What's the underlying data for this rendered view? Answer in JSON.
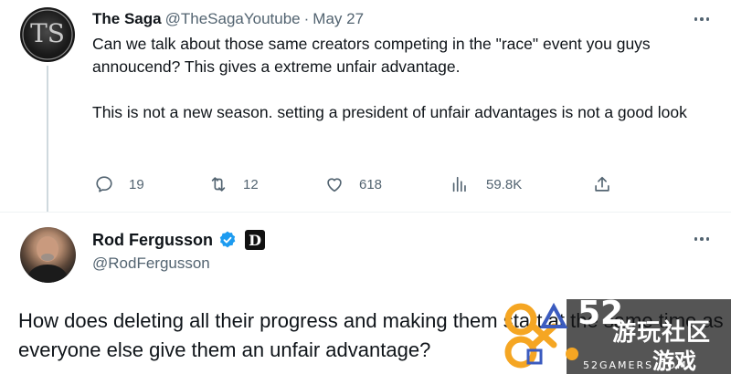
{
  "reply_tweet": {
    "author_name": "The Saga",
    "author_handle": "@TheSagaYoutube",
    "separator": "·",
    "date": "May 27",
    "paragraph1": "Can we talk about those same creators competing in the \"race\" event you guys annoucend? This gives a extreme unfair advantage.",
    "paragraph2": "This is not a new season. setting a president of unfair advantages is not a good look",
    "stats": {
      "replies": "19",
      "retweets": "12",
      "likes": "618",
      "views": "59.8K"
    }
  },
  "main_tweet": {
    "author_name": "Rod Fergusson",
    "author_handle": "@RodFergusson",
    "affiliate_badge": "D",
    "text": "How does deleting all their progress and making them start at the same time as everyone else give them an unfair advantage?"
  },
  "watermark": {
    "number": "52",
    "cn_line1": "游玩社区",
    "cn_line2": "游戏",
    "site": "52GAMERS.COM",
    "accent_color": "#f5a623"
  },
  "colors": {
    "text_primary": "#0f1419",
    "text_secondary": "#536471",
    "verified": "#1d9bf0",
    "border": "#eff3f4",
    "thread_line": "#cfd9de"
  }
}
